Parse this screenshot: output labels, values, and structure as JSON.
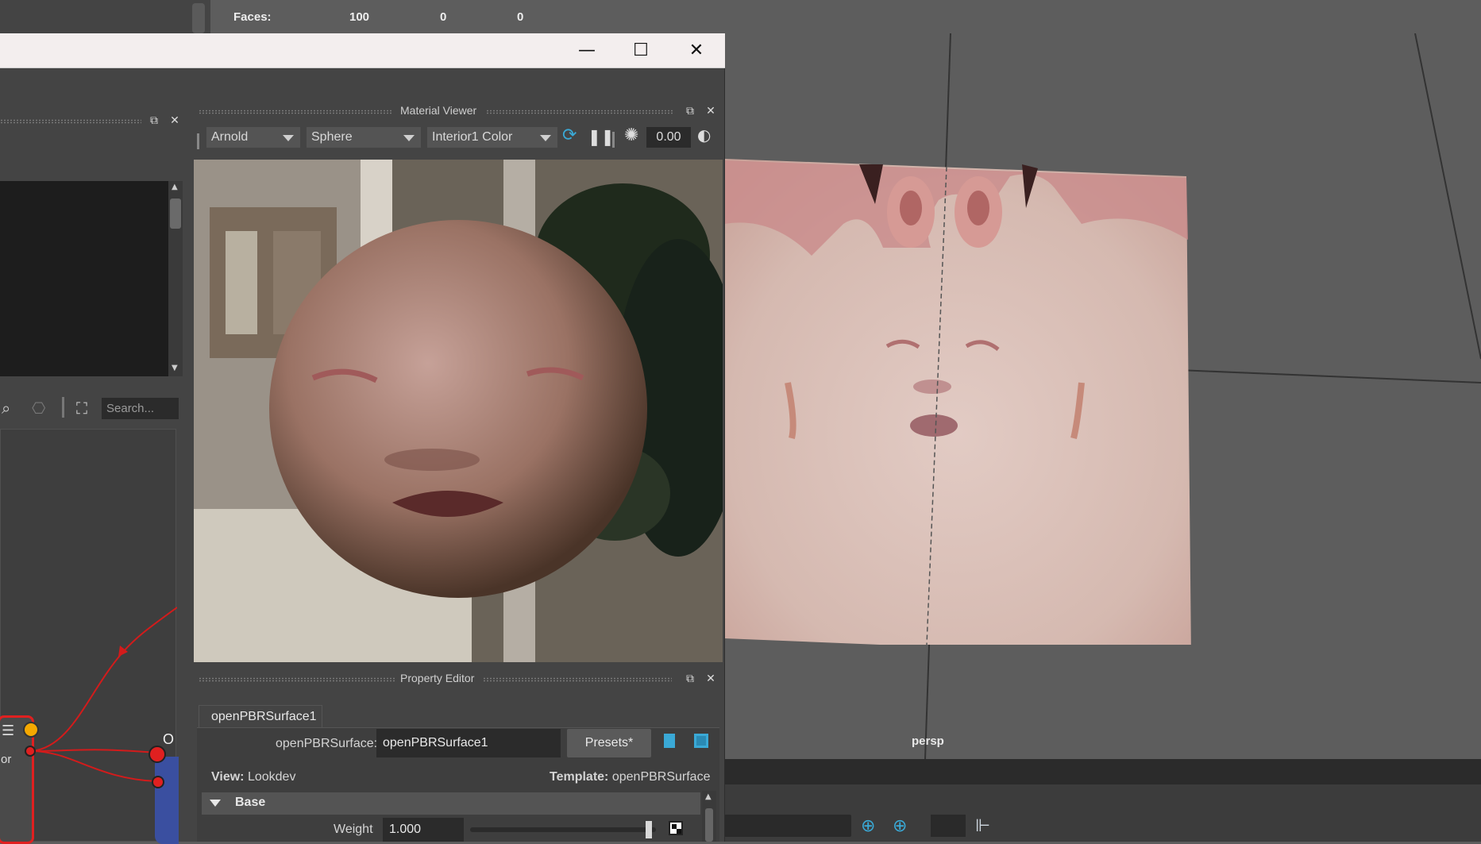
{
  "hud": {
    "faces_label": "Faces:",
    "faces_values": [
      "100",
      "0",
      "0"
    ]
  },
  "window": {
    "minimize_glyph": "—",
    "maximize_glyph": "☐",
    "close_glyph": "✕"
  },
  "left_panel": {
    "search_placeholder": "Search...",
    "node_port_label": "or",
    "node_out_label": "O"
  },
  "material_viewer": {
    "title": "Material Viewer",
    "renderer": "Arnold",
    "shape": "Sphere",
    "environment": "Interior1 Color",
    "exposure": "0.00"
  },
  "property_editor": {
    "title": "Property Editor",
    "tab": "openPBRSurface1",
    "node_type_label": "openPBRSurface:",
    "node_name": "openPBRSurface1",
    "presets_label": "Presets*",
    "view_label": "View:",
    "view_value": "Lookdev",
    "template_label": "Template:",
    "template_value": "openPBRSurface",
    "section": "Base",
    "weight_label": "Weight",
    "weight_value": "1.000",
    "weight_fraction": 0.96
  },
  "viewport": {
    "camera_label": "persp"
  },
  "colors": {
    "accent_blue": "#3aa9d6",
    "node_red": "#e02020",
    "node_yellow": "#f5a800"
  }
}
